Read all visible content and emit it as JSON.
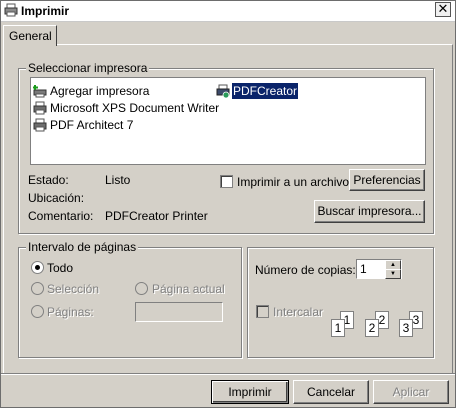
{
  "window": {
    "title": "Imprimir",
    "close": "✕"
  },
  "tabs": [
    {
      "label": "General"
    }
  ],
  "printer_group": {
    "label": "Seleccionar impresora",
    "printers": [
      {
        "name": "Agregar impresora",
        "icon": "add-printer-icon"
      },
      {
        "name": "Microsoft XPS Document Writer",
        "icon": "printer-icon"
      },
      {
        "name": "PDF Architect 7",
        "icon": "printer-icon"
      },
      {
        "name": "PDFCreator",
        "icon": "printer-icon",
        "selected": true
      }
    ],
    "status_label": "Estado:",
    "status_value": "Listo",
    "location_label": "Ubicación:",
    "location_value": "",
    "comment_label": "Comentario:",
    "comment_value": "PDFCreator Printer",
    "print_to_file_label": "Imprimir a un archivo",
    "print_to_file_checked": false,
    "preferences_button": "Preferencias",
    "find_printer_button": "Buscar impresora..."
  },
  "range_group": {
    "label": "Intervalo de páginas",
    "all_label": "Todo",
    "selection_label": "Selección",
    "current_page_label": "Página actual",
    "pages_label": "Páginas:",
    "pages_value": ""
  },
  "copies_group": {
    "copies_label": "Número de copias:",
    "copies_value": "1",
    "collate_label": "Intercalar",
    "collate_checked": false,
    "collate_pages": [
      "1",
      "1",
      "2",
      "2",
      "3",
      "3"
    ]
  },
  "footer": {
    "print_button": "Imprimir",
    "cancel_button": "Cancelar",
    "apply_button": "Aplicar"
  },
  "colors": {
    "selection": "#0a246a",
    "dialog_face": "#d4d0c8"
  }
}
